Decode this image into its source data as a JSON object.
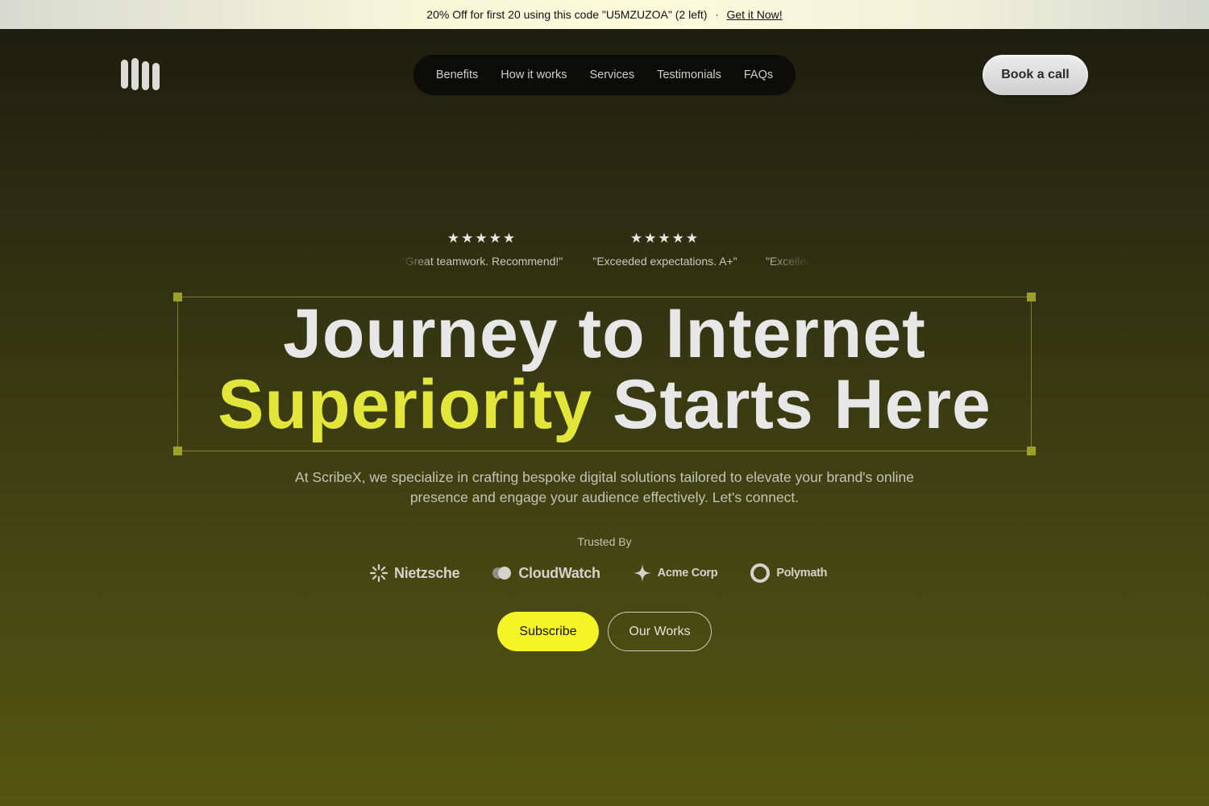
{
  "promo": {
    "text": "20% Off for first 20 using this code \"U5MZUZOA\" (2 left)",
    "separator": "·",
    "link": "Get it Now!"
  },
  "nav": {
    "items": [
      "Benefits",
      "How it works",
      "Services",
      "Testimonials",
      "FAQs"
    ],
    "cta": "Book a call"
  },
  "reviews": [
    {
      "stars": "★★★★★",
      "rating": 5,
      "quote": "\"Great teamwork. Recommend!\""
    },
    {
      "stars": "★★★★★",
      "rating": 5,
      "quote": "\"Exceeded expectations. A+\""
    },
    {
      "stars": "★★★★★",
      "rating": 5,
      "quote": "\"Excellent"
    }
  ],
  "hero": {
    "line1": "Journey to Internet",
    "accent": "Superiority",
    "line2_rest": " Starts Here",
    "subtitle": "At ScribeX, we specialize in crafting bespoke digital solutions tailored to elevate your brand's online presence and engage your audience effectively. Let's connect."
  },
  "trusted": {
    "label": "Trusted By",
    "brands": [
      {
        "name": "Nietzsche",
        "icon": "sunburst-icon"
      },
      {
        "name": "CloudWatch",
        "icon": "cloud-icon"
      },
      {
        "name": "Acme Corp",
        "icon": "sparkle-icon"
      },
      {
        "name": "Polymath",
        "icon": "ring-icon"
      }
    ]
  },
  "actions": {
    "subscribe": "Subscribe",
    "works": "Our Works"
  },
  "colors": {
    "accent": "#e3e63a",
    "subscribe_bg": "#f4f426",
    "frame_handle": "#9da029"
  }
}
